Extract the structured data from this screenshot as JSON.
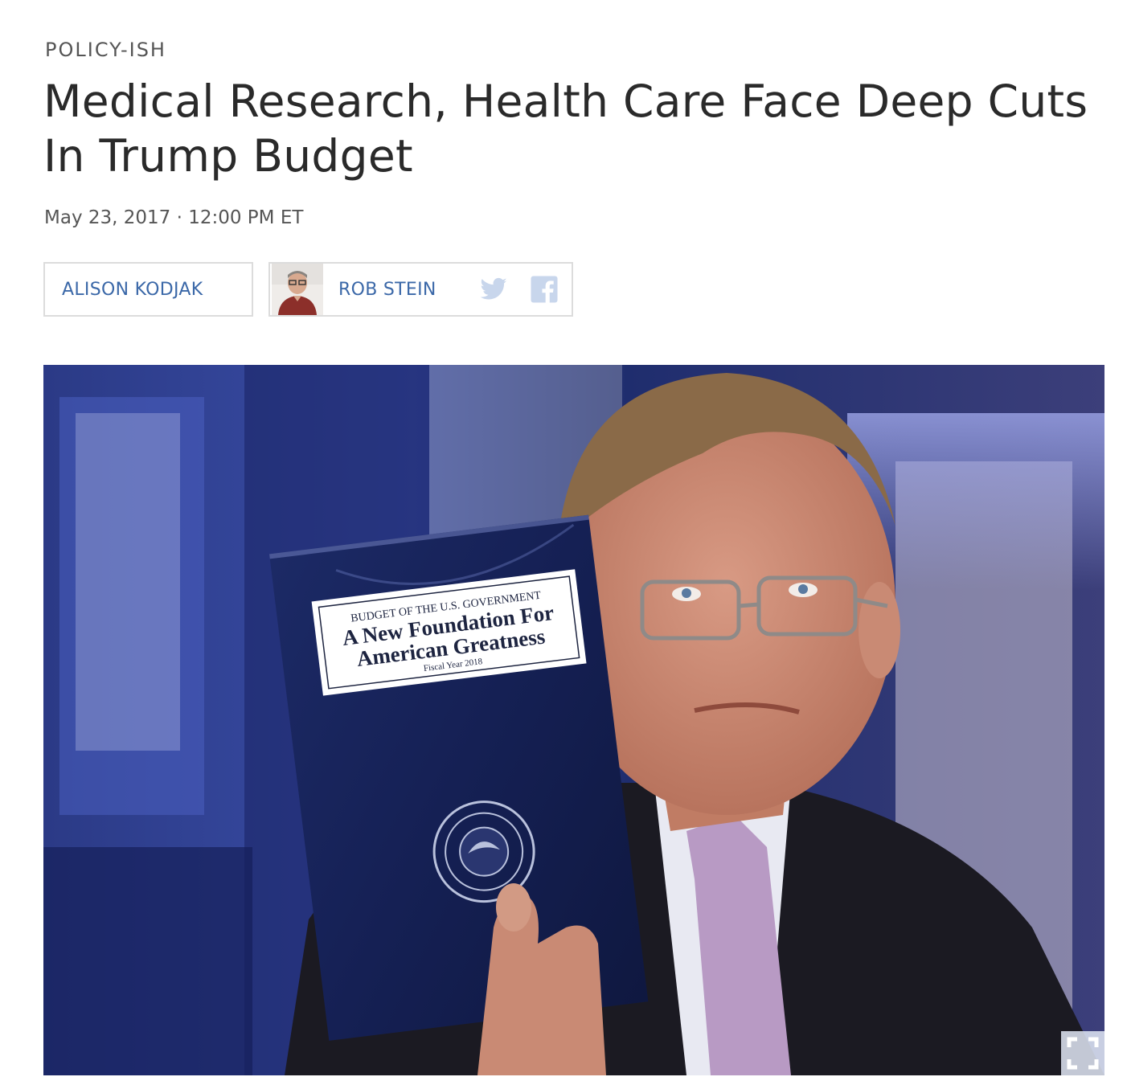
{
  "article": {
    "section": "POLICY-ISH",
    "title": "Medical Research, Health Care Face Deep Cuts In Trump Budget",
    "date": "May 23, 2017 · 12:00 PM ET"
  },
  "bylines": [
    {
      "name": "ALISON KODJAK",
      "has_photo": false
    },
    {
      "name": "ROB STEIN",
      "has_photo": true
    }
  ],
  "share": {
    "twitter_icon": "twitter-icon",
    "facebook_icon": "facebook-icon"
  },
  "image": {
    "booklet": {
      "line1": "BUDGET OF THE U.S. GOVERNMENT",
      "line2": "A New Foundation For",
      "line3": "American Greatness",
      "line4": "Fiscal Year 2018"
    },
    "enlarge_icon": "expand-icon"
  },
  "colors": {
    "link": "#3b68a8",
    "text": "#2a2a2a",
    "muted": "#555555",
    "border": "#dcdcdc",
    "share_icons": "#c8d6ec"
  }
}
